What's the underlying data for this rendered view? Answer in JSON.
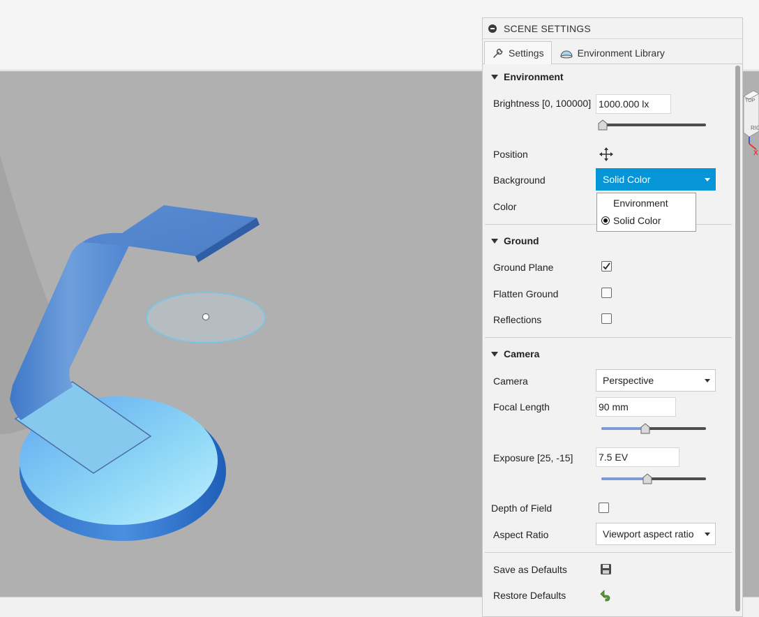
{
  "panel": {
    "title": "SCENE SETTINGS",
    "tabs": [
      {
        "label": "Settings",
        "icon": "wrench-icon",
        "active": true
      },
      {
        "label": "Environment Library",
        "icon": "environment-dome-icon",
        "active": false
      }
    ]
  },
  "environment": {
    "header": "Environment",
    "brightness_label": "Brightness [0, 100000]",
    "brightness_value": "1000.000 lx",
    "brightness_level": 0.01,
    "position_label": "Position",
    "position_icon": "move-arrows-icon",
    "background_label": "Background",
    "background_value": "Solid Color",
    "background_options": [
      {
        "label": "Environment",
        "selected": false
      },
      {
        "label": "Solid Color",
        "selected": true
      }
    ],
    "color_label": "Color"
  },
  "ground": {
    "header": "Ground",
    "ground_plane_label": "Ground Plane",
    "ground_plane_checked": true,
    "flatten_label": "Flatten Ground",
    "flatten_checked": false,
    "reflections_label": "Reflections",
    "reflections_checked": false
  },
  "camera": {
    "header": "Camera",
    "camera_label": "Camera",
    "camera_value": "Perspective",
    "focal_label": "Focal Length",
    "focal_value": "90 mm",
    "focal_level": 0.42,
    "exposure_label": "Exposure [25, -15]",
    "exposure_value": "7.5 EV",
    "exposure_level": 0.44,
    "dof_label": "Depth of Field",
    "dof_checked": false,
    "aspect_label": "Aspect Ratio",
    "aspect_value": "Viewport aspect ratio"
  },
  "defaults": {
    "save_label": "Save as Defaults",
    "save_icon": "floppy-disk-icon",
    "restore_label": "Restore Defaults",
    "restore_icon": "undo-arrow-icon",
    "restore_color": "#5a9a3a"
  },
  "viewcube": {
    "top_label": "TOP",
    "right_label": "RIG",
    "axis_label": "X"
  },
  "colors": {
    "accent": "#0696d7",
    "slider_fill": "#7d9bd4",
    "model": "#5b8fd4"
  }
}
